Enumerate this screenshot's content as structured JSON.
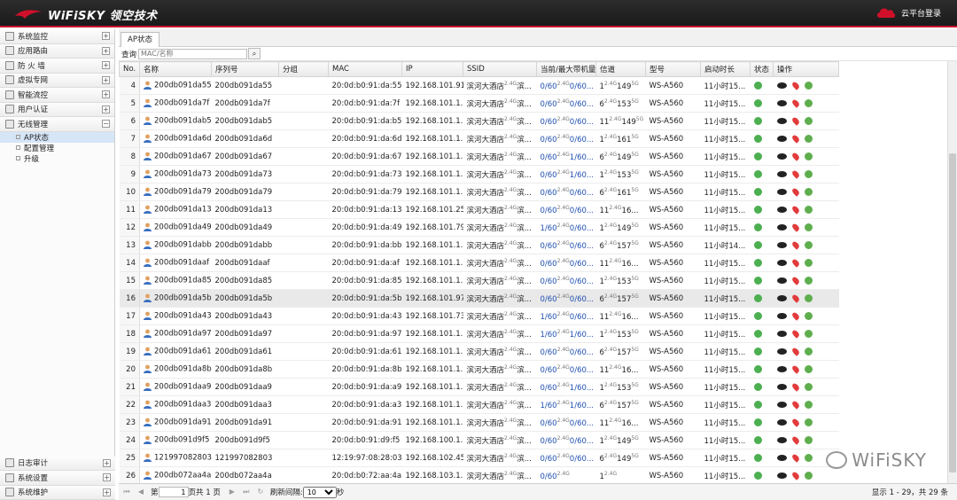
{
  "app": {
    "logo_text": "WiFiSKY 领空技术",
    "cloud_login": "云平台登录"
  },
  "sidebar": {
    "items": [
      {
        "label": "系统监控",
        "pm": "+"
      },
      {
        "label": "应用路由",
        "pm": "+"
      },
      {
        "label": "防 火 墙",
        "pm": "+"
      },
      {
        "label": "虚拟专网",
        "pm": "+"
      },
      {
        "label": "智能流控",
        "pm": "+"
      },
      {
        "label": "用户认证",
        "pm": "+"
      },
      {
        "label": "无线管理",
        "pm": "−"
      }
    ],
    "sub": [
      "AP状态",
      "配置管理",
      "升级"
    ],
    "bottom": [
      {
        "label": "日志审计",
        "pm": "+"
      },
      {
        "label": "系统设置",
        "pm": "+"
      },
      {
        "label": "系统维护",
        "pm": "+"
      }
    ]
  },
  "tab": "AP状态",
  "search": {
    "label": "查询",
    "placeholder": "MAC/名称"
  },
  "columns": [
    "No.",
    "名称",
    "序列号",
    "分组",
    "MAC",
    "IP",
    "SSID",
    "当前/最大带机量",
    "信道",
    "型号",
    "启动时长",
    "状态",
    "操作"
  ],
  "rows": [
    {
      "no": "4",
      "name": "200db091da55",
      "sn": "200db091da55",
      "mac": "20:0d:b0:91:da:55",
      "ip": "192.168.101.91",
      "load": "0/60",
      "load2": "0/60...",
      "ch1": "1",
      "ch2": "149",
      "uptime": "11小时15..."
    },
    {
      "no": "5",
      "name": "200db091da7f",
      "sn": "200db091da7f",
      "mac": "20:0d:b0:91:da:7f",
      "ip": "192.168.101.1...",
      "load": "0/60",
      "load2": "0/60...",
      "ch1": "6",
      "ch2": "153",
      "uptime": "11小时15..."
    },
    {
      "no": "6",
      "name": "200db091dab5",
      "sn": "200db091dab5",
      "mac": "20:0d:b0:91:da:b5",
      "ip": "192.168.101.1...",
      "load": "0/60",
      "load2": "0/60...",
      "ch1": "11",
      "ch2": "149",
      "uptime": "11小时15..."
    },
    {
      "no": "7",
      "name": "200db091da6d",
      "sn": "200db091da6d",
      "mac": "20:0d:b0:91:da:6d",
      "ip": "192.168.101.1...",
      "load": "0/60",
      "load2": "0/60...",
      "ch1": "1",
      "ch2": "161",
      "uptime": "11小时15..."
    },
    {
      "no": "8",
      "name": "200db091da67",
      "sn": "200db091da67",
      "mac": "20:0d:b0:91:da:67",
      "ip": "192.168.101.1...",
      "load": "0/60",
      "load2": "1/60...",
      "ch1": "6",
      "ch2": "149",
      "uptime": "11小时15..."
    },
    {
      "no": "9",
      "name": "200db091da73",
      "sn": "200db091da73",
      "mac": "20:0d:b0:91:da:73",
      "ip": "192.168.101.1...",
      "load": "0/60",
      "load2": "1/60...",
      "ch1": "1",
      "ch2": "153",
      "uptime": "11小时15..."
    },
    {
      "no": "10",
      "name": "200db091da79",
      "sn": "200db091da79",
      "mac": "20:0d:b0:91:da:79",
      "ip": "192.168.101.1...",
      "load": "0/60",
      "load2": "0/60...",
      "ch1": "6",
      "ch2": "161",
      "uptime": "11小时15..."
    },
    {
      "no": "11",
      "name": "200db091da13",
      "sn": "200db091da13",
      "mac": "20:0d:b0:91:da:13",
      "ip": "192.168.101.25",
      "load": "0/60",
      "load2": "0/60...",
      "ch1": "11",
      "ch2": "16...",
      "uptime": "11小时15..."
    },
    {
      "no": "12",
      "name": "200db091da49",
      "sn": "200db091da49",
      "mac": "20:0d:b0:91:da:49",
      "ip": "192.168.101.79",
      "load": "1/60",
      "load2": "0/60...",
      "ch1": "1",
      "ch2": "149",
      "uptime": "11小时15..."
    },
    {
      "no": "13",
      "name": "200db091dabb",
      "sn": "200db091dabb",
      "mac": "20:0d:b0:91:da:bb",
      "ip": "192.168.101.1...",
      "load": "0/60",
      "load2": "0/60...",
      "ch1": "6",
      "ch2": "157",
      "uptime": "11小时14..."
    },
    {
      "no": "14",
      "name": "200db091daaf",
      "sn": "200db091daaf",
      "mac": "20:0d:b0:91:da:af",
      "ip": "192.168.101.1...",
      "load": "0/60",
      "load2": "0/60...",
      "ch1": "11",
      "ch2": "16...",
      "uptime": "11小时15..."
    },
    {
      "no": "15",
      "name": "200db091da85",
      "sn": "200db091da85",
      "mac": "20:0d:b0:91:da:85",
      "ip": "192.168.101.1...",
      "load": "0/60",
      "load2": "0/60...",
      "ch1": "1",
      "ch2": "153",
      "uptime": "11小时15..."
    },
    {
      "no": "16",
      "name": "200db091da5b",
      "sn": "200db091da5b",
      "mac": "20:0d:b0:91:da:5b",
      "ip": "192.168.101.97",
      "load": "0/60",
      "load2": "0/60...",
      "ch1": "6",
      "ch2": "157",
      "uptime": "11小时15..."
    },
    {
      "no": "17",
      "name": "200db091da43",
      "sn": "200db091da43",
      "mac": "20:0d:b0:91:da:43",
      "ip": "192.168.101.73",
      "load": "1/60",
      "load2": "0/60...",
      "ch1": "11",
      "ch2": "16...",
      "uptime": "11小时15..."
    },
    {
      "no": "18",
      "name": "200db091da97",
      "sn": "200db091da97",
      "mac": "20:0d:b0:91:da:97",
      "ip": "192.168.101.1...",
      "load": "1/60",
      "load2": "1/60...",
      "ch1": "1",
      "ch2": "153",
      "uptime": "11小时15..."
    },
    {
      "no": "19",
      "name": "200db091da61",
      "sn": "200db091da61",
      "mac": "20:0d:b0:91:da:61",
      "ip": "192.168.101.1...",
      "load": "0/60",
      "load2": "0/60...",
      "ch1": "6",
      "ch2": "157",
      "uptime": "11小时15..."
    },
    {
      "no": "20",
      "name": "200db091da8b",
      "sn": "200db091da8b",
      "mac": "20:0d:b0:91:da:8b",
      "ip": "192.168.101.1...",
      "load": "0/60",
      "load2": "0/60...",
      "ch1": "11",
      "ch2": "16...",
      "uptime": "11小时15..."
    },
    {
      "no": "21",
      "name": "200db091daa9",
      "sn": "200db091daa9",
      "mac": "20:0d:b0:91:da:a9",
      "ip": "192.168.101.1...",
      "load": "0/60",
      "load2": "1/60...",
      "ch1": "1",
      "ch2": "153",
      "uptime": "11小时15..."
    },
    {
      "no": "22",
      "name": "200db091daa3",
      "sn": "200db091daa3",
      "mac": "20:0d:b0:91:da:a3",
      "ip": "192.168.101.1...",
      "load": "1/60",
      "load2": "1/60...",
      "ch1": "6",
      "ch2": "157",
      "uptime": "11小时15..."
    },
    {
      "no": "23",
      "name": "200db091da91",
      "sn": "200db091da91",
      "mac": "20:0d:b0:91:da:91",
      "ip": "192.168.101.1...",
      "load": "0/60",
      "load2": "0/60...",
      "ch1": "11",
      "ch2": "16...",
      "uptime": "11小时15..."
    },
    {
      "no": "24",
      "name": "200db091d9f5",
      "sn": "200db091d9f5",
      "mac": "20:0d:b0:91:d9:f5",
      "ip": "192.168.100.1...",
      "load": "0/60",
      "load2": "0/60...",
      "ch1": "1",
      "ch2": "149",
      "uptime": "11小时15..."
    },
    {
      "no": "25",
      "name": "121997082803",
      "sn": "121997082803",
      "mac": "12:19:97:08:28:03",
      "ip": "192.168.102.45",
      "load": "0/60",
      "load2": "0/60...",
      "ch1": "6",
      "ch2": "149",
      "uptime": "11小时15..."
    },
    {
      "no": "26",
      "name": "200db072aa4a",
      "sn": "200db072aa4a",
      "mac": "20:0d:b0:72:aa:4a",
      "ip": "192.168.103.1...",
      "load": "0/60",
      "load2": "",
      "ch1": "1",
      "ch2": "",
      "uptime": "11小时15..."
    }
  ],
  "row_const": {
    "ssid": "滨河大酒店",
    "ssid_band": "2.4G",
    "ssid_tail": "滨...",
    "band24": "2.4G",
    "band5": "5G",
    "model": "WS-A560"
  },
  "highlight_row": "16",
  "pager": {
    "page_label": "第",
    "page_value": "1",
    "page_total": "页共 1 页",
    "refresh_label": "刷新间隔:",
    "interval": "10",
    "unit": "秒",
    "summary": "显示 1 - 29，共 29 条"
  },
  "watermark": "WiFiSKY",
  "colors": {
    "topbar": "#1f1f1f",
    "accent_red": "#c8102e",
    "load_blue": "#2050b0",
    "status_green": "#4caf50"
  }
}
